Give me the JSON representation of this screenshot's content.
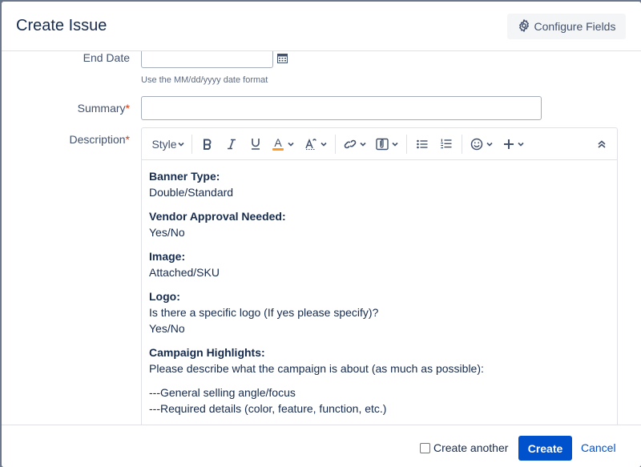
{
  "dialog": {
    "title": "Create Issue",
    "configure_fields_label": "Configure Fields"
  },
  "fields": {
    "end_date": {
      "label": "End Date",
      "value": "",
      "hint": "Use the MM/dd/yyyy date format"
    },
    "summary": {
      "label": "Summary",
      "required_mark": "*",
      "value": ""
    },
    "description": {
      "label": "Description",
      "required_mark": "*"
    }
  },
  "editor": {
    "toolbar": {
      "style_label": "Style",
      "text_color_letter": "A",
      "text_color": "#ff991f"
    },
    "content": [
      {
        "heading": "Banner Type:",
        "lines": [
          "Double/Standard"
        ]
      },
      {
        "heading": "Vendor Approval Needed:",
        "lines": [
          "Yes/No"
        ]
      },
      {
        "heading": "Image:",
        "lines": [
          "Attached/SKU"
        ]
      },
      {
        "heading": "Logo:",
        "lines": [
          "Is there a specific logo (If yes please specify)?",
          "Yes/No"
        ]
      },
      {
        "heading": "Campaign Highlights:",
        "lines": [
          "Please describe what the campaign is about (as much as possible):"
        ]
      },
      {
        "heading": "",
        "lines": [
          "---General selling angle/focus",
          "---Required details (color, feature, function, etc.)"
        ]
      }
    ]
  },
  "footer": {
    "create_another_label": "Create another",
    "create_another_checked": false,
    "create_label": "Create",
    "cancel_label": "Cancel"
  },
  "colors": {
    "primary": "#0052cc",
    "required": "#de350b",
    "backdrop": "#6b778c"
  }
}
